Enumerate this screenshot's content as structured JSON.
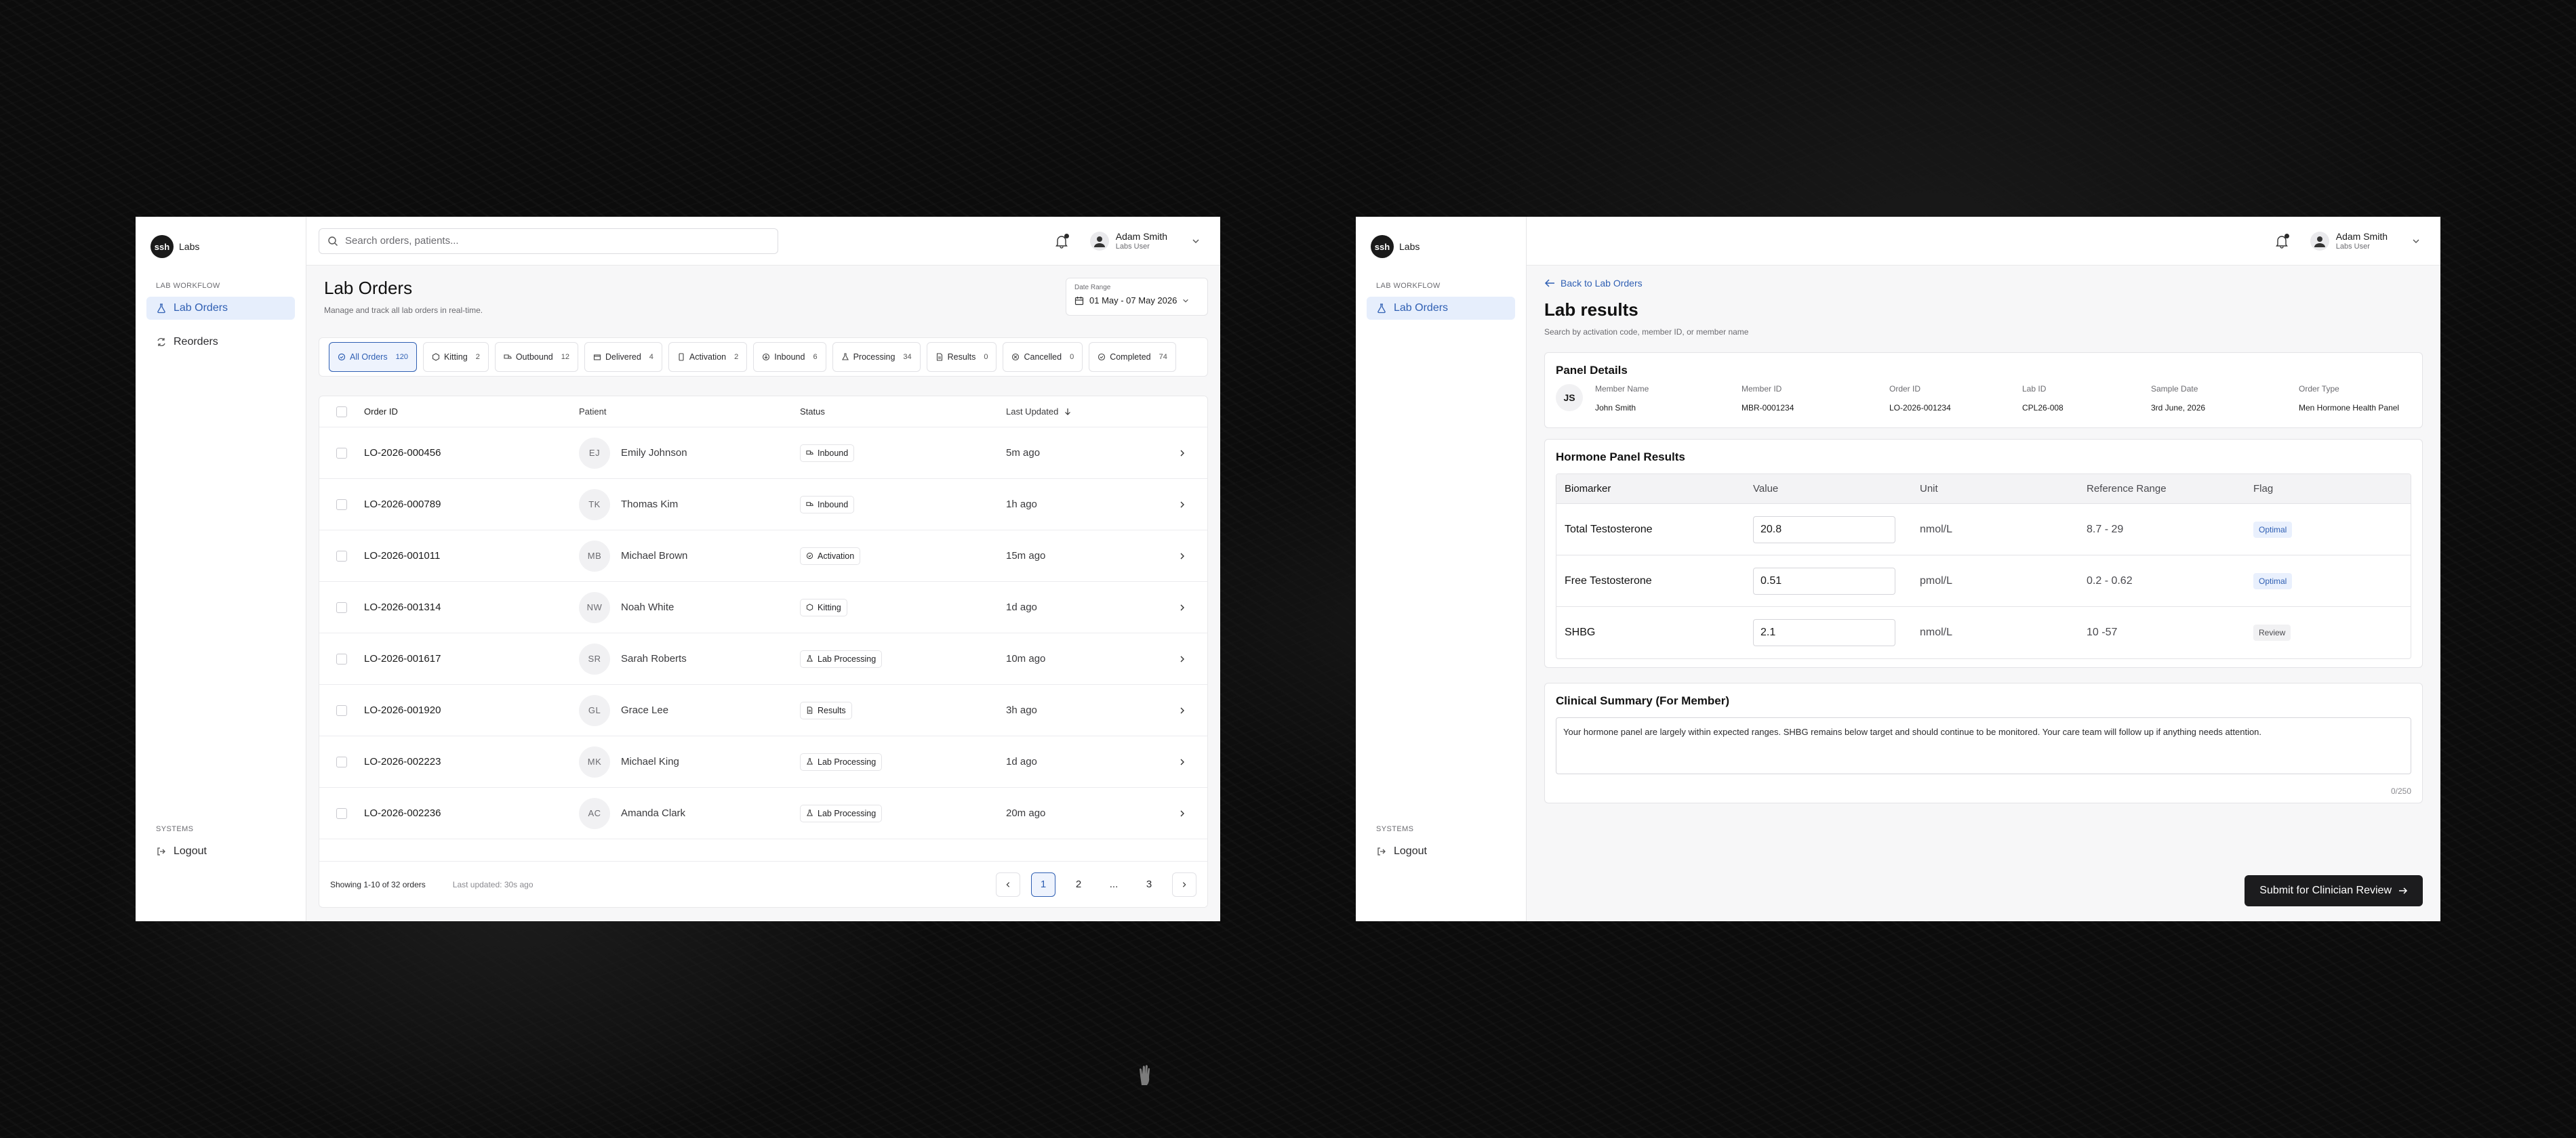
{
  "left": {
    "brand": {
      "logo_text": "ssh",
      "name": "Labs"
    },
    "sidebar": {
      "section": "LAB WORKFLOW",
      "items": [
        {
          "label": "Lab Orders",
          "icon": "flask-icon"
        },
        {
          "label": "Reorders",
          "icon": "refresh-icon"
        }
      ],
      "systems_section": "SYSTEMS",
      "logout_label": "Logout"
    },
    "topbar": {
      "search_placeholder": "Search orders, patients...",
      "user_name": "Adam Smith",
      "user_role": "Labs User"
    },
    "page": {
      "title": "Lab Orders",
      "subtitle": "Manage and track all lab orders in real-time.",
      "date_label": "Date Range",
      "date_value": "01 May - 07 May 2026"
    },
    "tabs": [
      {
        "label": "All Orders",
        "count": "120"
      },
      {
        "label": "Kitting",
        "count": "2"
      },
      {
        "label": "Outbound",
        "count": "12"
      },
      {
        "label": "Delivered",
        "count": "4"
      },
      {
        "label": "Activation",
        "count": "2"
      },
      {
        "label": "Inbound",
        "count": "6"
      },
      {
        "label": "Processing",
        "count": "34"
      },
      {
        "label": "Results",
        "count": "0"
      },
      {
        "label": "Cancelled",
        "count": "0"
      },
      {
        "label": "Completed",
        "count": "74"
      }
    ],
    "table": {
      "headers": {
        "order_id": "Order ID",
        "patient": "Patient",
        "status": "Status",
        "updated": "Last Updated"
      },
      "rows": [
        {
          "id": "LO-2026-000456",
          "initials": "EJ",
          "patient": "Emily Johnson",
          "status": "Inbound",
          "updated": "5m ago"
        },
        {
          "id": "LO-2026-000789",
          "initials": "TK",
          "patient": "Thomas Kim",
          "status": "Inbound",
          "updated": "1h ago"
        },
        {
          "id": "LO-2026-001011",
          "initials": "MB",
          "patient": "Michael Brown",
          "status": "Activation",
          "updated": "15m ago"
        },
        {
          "id": "LO-2026-001314",
          "initials": "NW",
          "patient": "Noah White",
          "status": "Kitting",
          "updated": "1d ago"
        },
        {
          "id": "LO-2026-001617",
          "initials": "SR",
          "patient": "Sarah Roberts",
          "status": "Lab Processing",
          "updated": "10m ago"
        },
        {
          "id": "LO-2026-001920",
          "initials": "GL",
          "patient": "Grace Lee",
          "status": "Results",
          "updated": "3h ago"
        },
        {
          "id": "LO-2026-002223",
          "initials": "MK",
          "patient": "Michael King",
          "status": "Lab Processing",
          "updated": "1d ago"
        },
        {
          "id": "LO-2026-002236",
          "initials": "AC",
          "patient": "Amanda Clark",
          "status": "Lab Processing",
          "updated": "20m ago"
        }
      ],
      "footer_showing": "Showing 1-10 of 32 orders",
      "footer_updated": "Last updated: 30s ago",
      "pages": [
        "1",
        "2",
        "...",
        "3"
      ]
    }
  },
  "right": {
    "brand": {
      "logo_text": "ssh",
      "name": "Labs"
    },
    "sidebar": {
      "section": "LAB WORKFLOW",
      "items": [
        {
          "label": "Lab Orders",
          "icon": "flask-icon"
        }
      ],
      "systems_section": "SYSTEMS",
      "logout_label": "Logout"
    },
    "topbar": {
      "user_name": "Adam Smith",
      "user_role": "Labs User"
    },
    "back_label": "Back to Lab Orders",
    "title": "Lab results",
    "subtitle": "Search by activation code, member ID, or member name",
    "panel": {
      "title": "Panel Details",
      "initials": "JS",
      "fields": [
        {
          "label": "Member Name",
          "value": "John Smith"
        },
        {
          "label": "Member ID",
          "value": "MBR-0001234"
        },
        {
          "label": "Order ID",
          "value": "LO-2026-001234"
        },
        {
          "label": "Lab ID",
          "value": "CPL26-008"
        },
        {
          "label": "Sample Date",
          "value": "3rd June, 2026"
        },
        {
          "label": "Order Type",
          "value": "Men Hormone Health Panel"
        }
      ]
    },
    "hormone": {
      "title": "Hormone Panel Results",
      "headers": {
        "biomarker": "Biomarker",
        "value": "Value",
        "unit": "Unit",
        "range": "Reference Range",
        "flag": "Flag"
      },
      "rows": [
        {
          "biomarker": "Total Testosterone",
          "value": "20.8",
          "unit": "nmol/L",
          "range": "8.7 - 29",
          "flag": "Optimal"
        },
        {
          "biomarker": "Free Testosterone",
          "value": "0.51",
          "unit": "pmol/L",
          "range": "0.2 - 0.62",
          "flag": "Optimal"
        },
        {
          "biomarker": "SHBG",
          "value": "2.1",
          "unit": "nmol/L",
          "range": "10 -57",
          "flag": "Review"
        }
      ]
    },
    "summary": {
      "title": "Clinical Summary (For Member)",
      "text": "Your hormone panel are largely within expected ranges. SHBG remains below target and should continue to be monitored. Your care team will follow up if anything needs attention.",
      "counter": "0/250"
    },
    "submit_label": "Submit for Clinician Review"
  },
  "colors": {
    "accent": "#2f5fb3",
    "accent_bg": "#e6eefc",
    "dark": "#1c1c1e"
  }
}
